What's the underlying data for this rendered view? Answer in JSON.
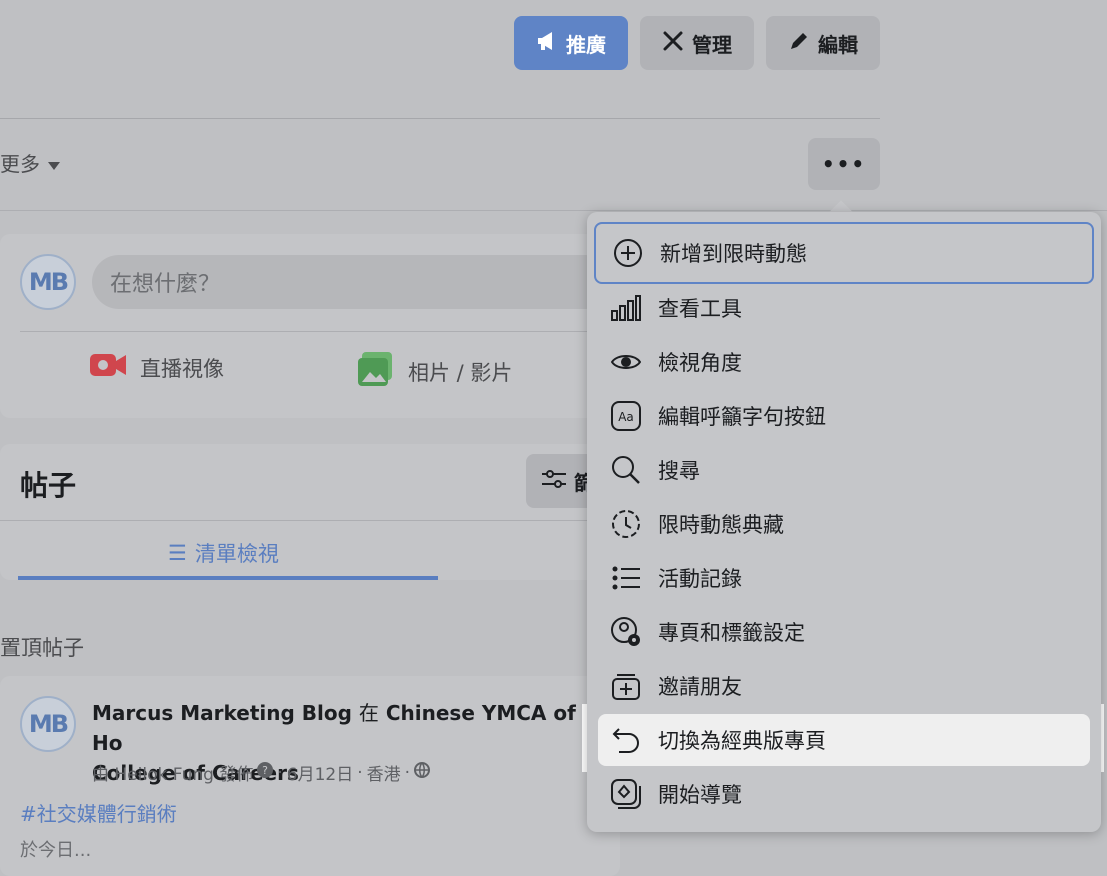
{
  "header": {
    "promote_label": "推廣",
    "manage_label": "管理",
    "edit_label": "編輯",
    "more_tab_label": "更多"
  },
  "composer": {
    "avatar_text": "MB",
    "placeholder": "在想什麼？",
    "live_label": "直播視像",
    "photo_label": "相片 / 影片"
  },
  "posts": {
    "title": "帖子",
    "filter_label": "篩",
    "list_view_label": "清單檢視",
    "pinned_label": "置頂帖子"
  },
  "post": {
    "avatar_text": "MB",
    "author": "Marcus Marketing Blog",
    "at_word": "在",
    "location": "Chinese YMCA of Ho",
    "location_line2": "College of Careers",
    "meta_by": "由 Heilok Fung 發佈",
    "meta_date": "6月12日",
    "meta_place": "香港",
    "hashtag": "#社交媒體行銷術",
    "tail_text": "於今日..."
  },
  "menu": {
    "items": [
      {
        "label": "新增到限時動態",
        "icon": "add-circle-icon"
      },
      {
        "label": "查看工具",
        "icon": "bar-chart-icon"
      },
      {
        "label": "檢視角度",
        "icon": "eye-icon"
      },
      {
        "label": "編輯呼籲字句按鈕",
        "icon": "aa-icon"
      },
      {
        "label": "搜尋",
        "icon": "search-icon"
      },
      {
        "label": "限時動態典藏",
        "icon": "archive-clock-icon"
      },
      {
        "label": "活動記錄",
        "icon": "list-icon"
      },
      {
        "label": "專頁和標籤設定",
        "icon": "settings-person-icon"
      },
      {
        "label": "邀請朋友",
        "icon": "invite-icon"
      },
      {
        "label": "切換為經典版專頁",
        "icon": "undo-arrow-icon"
      },
      {
        "label": "開始導覽",
        "icon": "tour-icon"
      }
    ]
  },
  "colors": {
    "accent": "#5f84c6",
    "link": "#5a7ec0",
    "highlight": "#ffffff"
  }
}
